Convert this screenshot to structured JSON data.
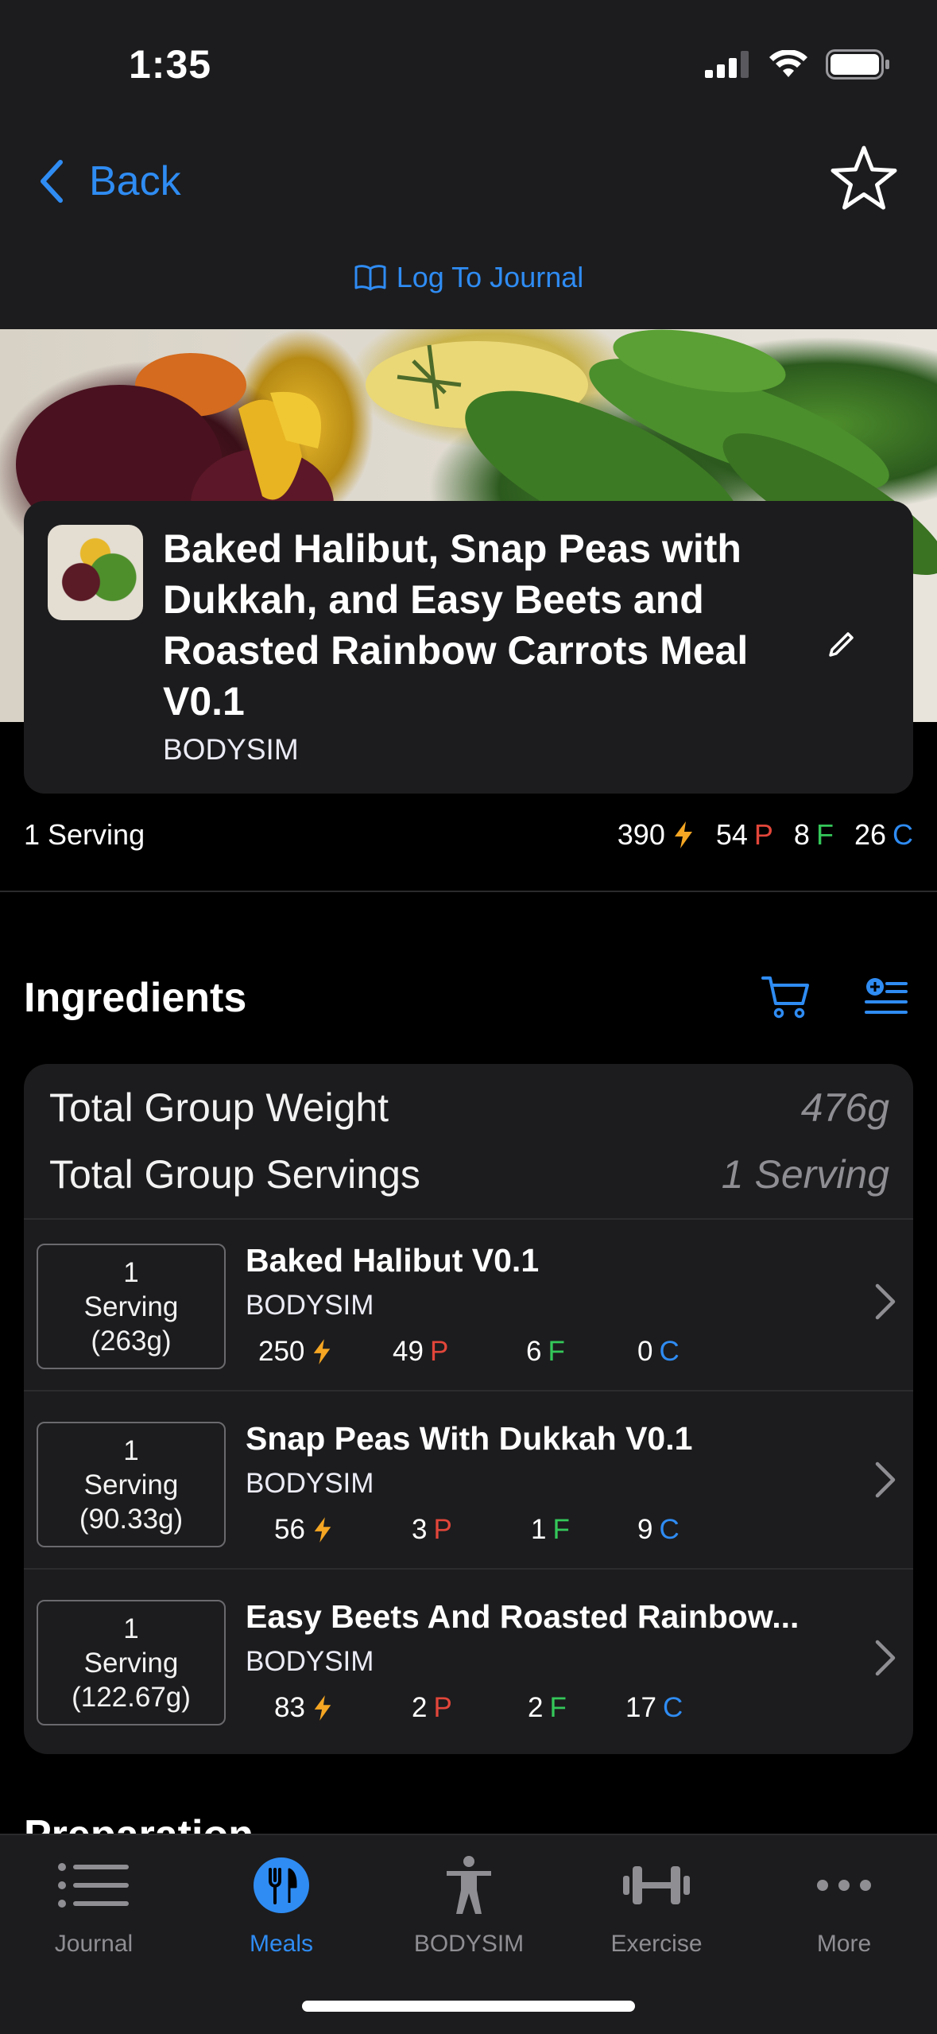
{
  "status": {
    "time": "1:35"
  },
  "nav": {
    "back_label": "Back",
    "log_label": "Log To Journal"
  },
  "meal": {
    "title": "Baked Halibut, Snap Peas with Dukkah, and Easy Beets and Roasted Rainbow Carrots Meal V0.1",
    "brand": "BODYSIM",
    "serving": "1 Serving",
    "macros": {
      "cal": "390",
      "p": "54",
      "f": "8",
      "c": "26",
      "p_unit": "P",
      "f_unit": "F",
      "c_unit": "C"
    }
  },
  "ingredients": {
    "title": "Ingredients",
    "total_weight_label": "Total Group Weight",
    "total_weight_value": "476g",
    "total_servings_label": "Total Group Servings",
    "total_servings_value": "1 Serving",
    "items": [
      {
        "qty": "1",
        "unit": "Serving",
        "weight": "(263g)",
        "name": "Baked Halibut V0.1",
        "brand": "BODYSIM",
        "cal": "250",
        "p": "49",
        "f": "6",
        "c": "0"
      },
      {
        "qty": "1",
        "unit": "Serving",
        "weight": "(90.33g)",
        "name": "Snap Peas With Dukkah V0.1",
        "brand": "BODYSIM",
        "cal": "56",
        "p": "3",
        "f": "1",
        "c": "9"
      },
      {
        "qty": "1",
        "unit": "Serving",
        "weight": "(122.67g)",
        "name": "Easy Beets And Roasted Rainbow...",
        "brand": "BODYSIM",
        "cal": "83",
        "p": "2",
        "f": "2",
        "c": "17"
      }
    ]
  },
  "preparation": {
    "title": "Preparation"
  },
  "tabs": [
    {
      "label": "Journal",
      "icon": "list-icon"
    },
    {
      "label": "Meals",
      "icon": "fork-knife-icon",
      "active": true
    },
    {
      "label": "BODYSIM",
      "icon": "person-icon"
    },
    {
      "label": "Exercise",
      "icon": "dumbbell-icon"
    },
    {
      "label": "More",
      "icon": "ellipsis-icon"
    }
  ],
  "colors": {
    "accent": "#2f8cf3",
    "protein": "#e2463a",
    "fat": "#34c759",
    "carb": "#2f8cf3",
    "energy": "#f5a623",
    "surface": "#1c1c1e"
  }
}
